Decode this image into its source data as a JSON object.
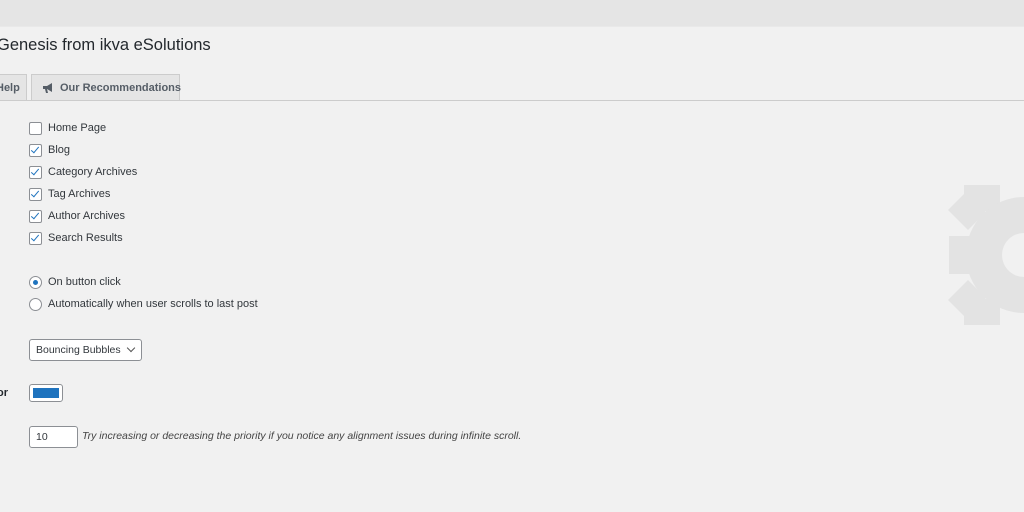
{
  "page": {
    "title": "Genesis from ikva eSolutions"
  },
  "tabs": [
    {
      "label": "Help"
    },
    {
      "label": "Our Recommendations",
      "icon": "megaphone-icon"
    }
  ],
  "archives": [
    {
      "label": "Home Page",
      "checked": false
    },
    {
      "label": "Blog",
      "checked": true
    },
    {
      "label": "Category Archives",
      "checked": true
    },
    {
      "label": "Tag Archives",
      "checked": true
    },
    {
      "label": "Author Archives",
      "checked": true
    },
    {
      "label": "Search Results",
      "checked": true
    }
  ],
  "load_mode": [
    {
      "label": "On button click",
      "checked": true
    },
    {
      "label": "Automatically when user scrolls to last post",
      "checked": false
    }
  ],
  "loader": {
    "selected": "Bouncing Bubbles"
  },
  "color_field": {
    "label_fragment": "or",
    "value": "#1e73be"
  },
  "priority": {
    "value": "10",
    "hint": "Try increasing or decreasing the priority if you notice any alignment issues during infinite scroll."
  },
  "decor": {
    "background_icon": "gear-icon",
    "accent": "#1e73be"
  }
}
